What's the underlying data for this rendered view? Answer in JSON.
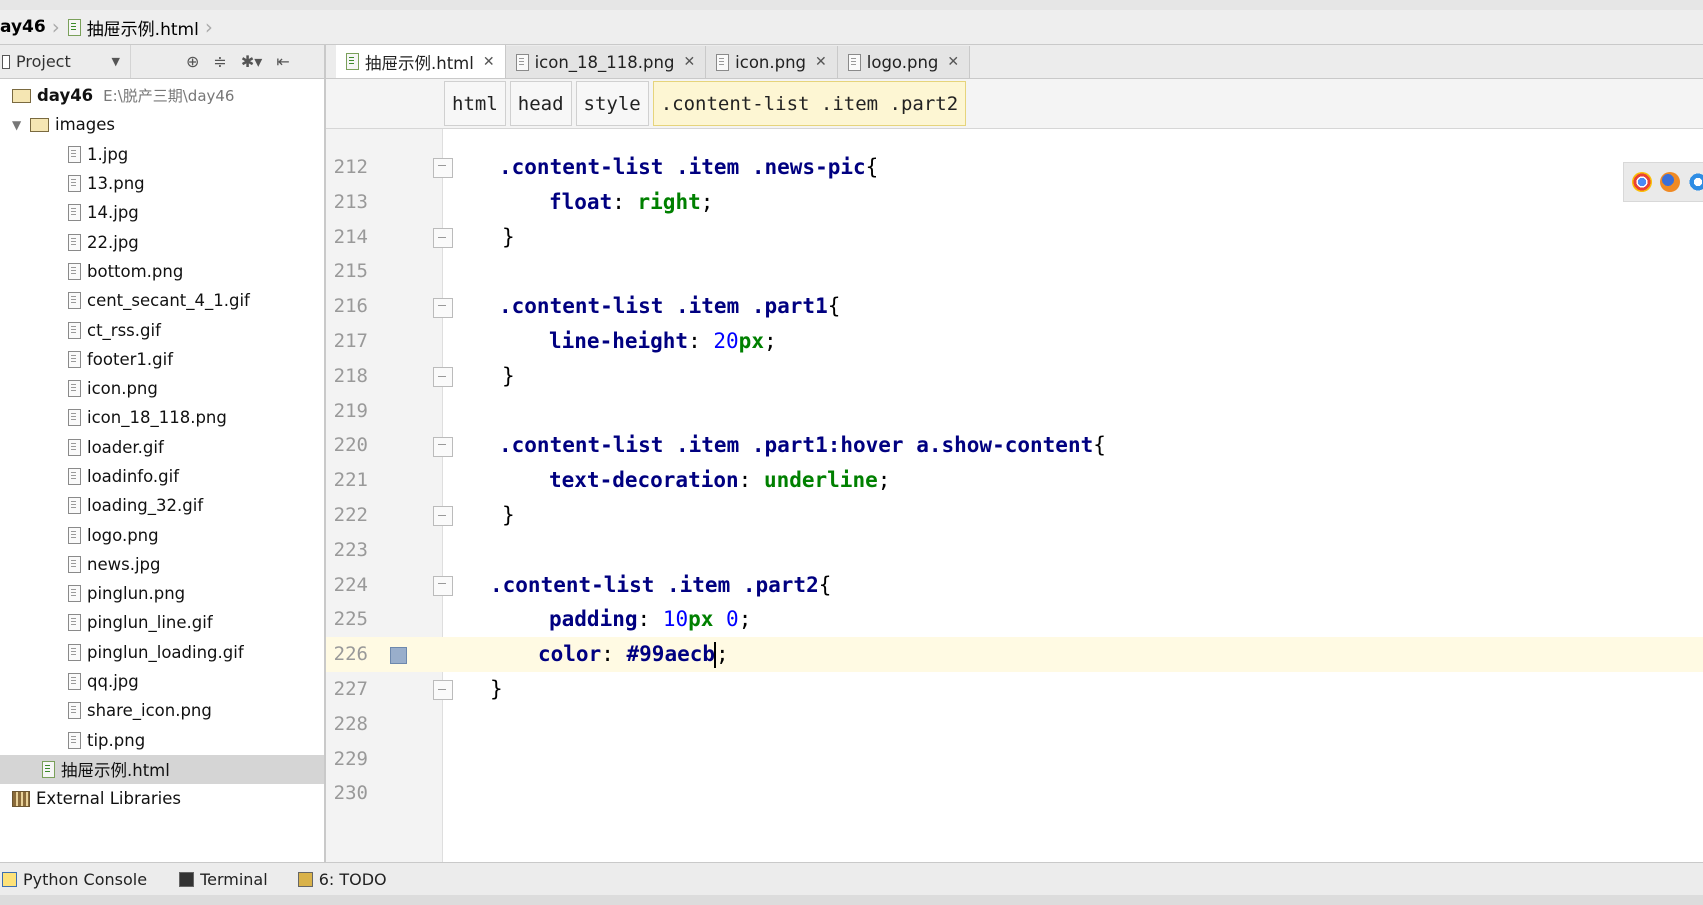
{
  "window": {
    "breadcrumb": [
      "ay46",
      "抽屉示例.html"
    ]
  },
  "sidebar": {
    "header_label": "Project",
    "root": {
      "name": "day46",
      "path": "E:\\脱产三期\\day46"
    },
    "folder": "images",
    "files": [
      "1.jpg",
      "13.png",
      "14.jpg",
      "22.jpg",
      "bottom.png",
      "cent_secant_4_1.gif",
      "ct_rss.gif",
      "footer1.gif",
      "icon.png",
      "icon_18_118.png",
      "loader.gif",
      "loadinfo.gif",
      "loading_32.gif",
      "logo.png",
      "news.jpg",
      "pinglun.png",
      "pinglun_line.gif",
      "pinglun_loading.gif",
      "qq.jpg",
      "share_icon.png",
      "tip.png"
    ],
    "selected_file": "抽屉示例.html",
    "external": "External Libraries"
  },
  "tabs": [
    {
      "label": "抽屉示例.html",
      "active": true
    },
    {
      "label": "icon_18_118.png",
      "active": false
    },
    {
      "label": "icon.png",
      "active": false
    },
    {
      "label": "logo.png",
      "active": false
    }
  ],
  "code_breadcrumb": [
    "html",
    "head",
    "style",
    ".content-list .item .part2"
  ],
  "code": {
    "lines": [
      {
        "n": "212",
        "fold": "open",
        "parts": [
          [
            "s",
            ".content-list .item .news-pic"
          ],
          [
            "p",
            "{"
          ]
        ]
      },
      {
        "n": "213",
        "fold": "",
        "parts": [
          [
            "pr",
            "float"
          ],
          [
            "p",
            ": "
          ],
          [
            "v",
            "right"
          ],
          [
            "p",
            ";"
          ]
        ]
      },
      {
        "n": "214",
        "fold": "close",
        "parts": [
          [
            "p",
            "}"
          ]
        ]
      },
      {
        "n": "215",
        "fold": "",
        "parts": []
      },
      {
        "n": "216",
        "fold": "open",
        "parts": [
          [
            "s",
            ".content-list .item .part1"
          ],
          [
            "p",
            "{"
          ]
        ]
      },
      {
        "n": "217",
        "fold": "",
        "parts": [
          [
            "pr",
            "line-height"
          ],
          [
            "p",
            ": "
          ],
          [
            "nm",
            "20"
          ],
          [
            "v",
            "px"
          ],
          [
            "p",
            ";"
          ]
        ]
      },
      {
        "n": "218",
        "fold": "close",
        "parts": [
          [
            "p",
            "}"
          ]
        ]
      },
      {
        "n": "219",
        "fold": "",
        "parts": []
      },
      {
        "n": "220",
        "fold": "open",
        "parts": [
          [
            "s",
            ".content-list .item .part1:hover a.show-content"
          ],
          [
            "p",
            "{"
          ]
        ]
      },
      {
        "n": "221",
        "fold": "",
        "parts": [
          [
            "pr",
            "text-decoration"
          ],
          [
            "p",
            ": "
          ],
          [
            "v",
            "underline"
          ],
          [
            "p",
            ";"
          ]
        ]
      },
      {
        "n": "222",
        "fold": "close",
        "parts": [
          [
            "p",
            "}"
          ]
        ]
      },
      {
        "n": "223",
        "fold": "",
        "parts": []
      },
      {
        "n": "224",
        "fold": "open",
        "parts": [
          [
            "s",
            ".content-list .item .part2"
          ],
          [
            "p",
            "{"
          ]
        ]
      },
      {
        "n": "225",
        "fold": "",
        "parts": [
          [
            "pr",
            "padding"
          ],
          [
            "p",
            ": "
          ],
          [
            "nm",
            "10"
          ],
          [
            "v",
            "px "
          ],
          [
            "nm",
            "0"
          ],
          [
            "p",
            ";"
          ]
        ]
      },
      {
        "n": "226",
        "fold": "",
        "parts": [
          [
            "pr",
            "color"
          ],
          [
            "p",
            ": "
          ],
          [
            "pr",
            "#99aecb"
          ],
          [
            "p",
            ";"
          ]
        ]
      },
      {
        "n": "227",
        "fold": "close",
        "parts": [
          [
            "p",
            "}"
          ]
        ]
      },
      {
        "n": "228",
        "fold": "",
        "parts": []
      },
      {
        "n": "229",
        "fold": "",
        "parts": []
      },
      {
        "n": "230",
        "fold": "",
        "parts": []
      }
    ]
  },
  "swatch_color": "#99aecb",
  "statusbar": {
    "python_console": "Python Console",
    "terminal": "Terminal",
    "todo": "6: TODO"
  }
}
